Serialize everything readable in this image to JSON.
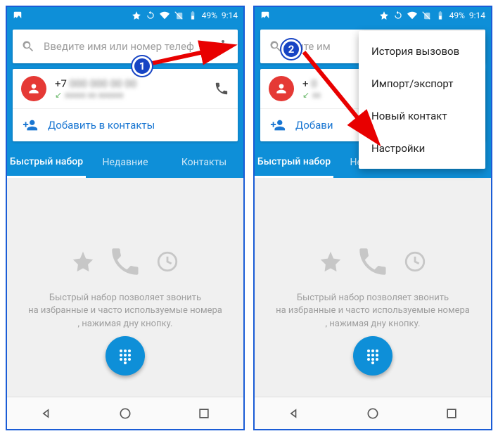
{
  "statusbar": {
    "battery": "49%",
    "time": "9:14"
  },
  "search": {
    "placeholder": "Введите имя или номер телеф"
  },
  "search2": {
    "visible_text": "дите им"
  },
  "recent": {
    "number_prefix": "+7",
    "number_prefix2": "+",
    "arrow": "↙"
  },
  "add_contacts": "Добавить в контакты",
  "add_contacts2": "Добави",
  "tabs": {
    "speed": "Быстрый набор",
    "recent": "Недавние",
    "contacts": "Контакты"
  },
  "empty": {
    "line1": "Быстрый набор позволяет звонить",
    "line2": "на избранные и часто используемые номера",
    "line3": ", нажимая               дну кнопку."
  },
  "menu": {
    "history": "История вызовов",
    "import": "Импорт/экспорт",
    "new_contact": "Новый контакт",
    "settings": "Настройки"
  },
  "annot": {
    "one": "1",
    "two": "2"
  }
}
